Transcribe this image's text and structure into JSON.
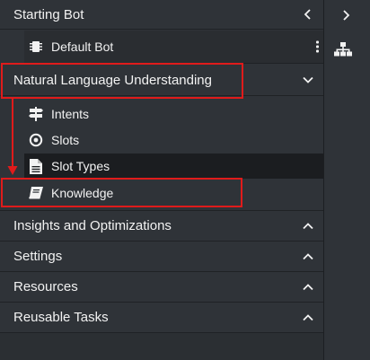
{
  "bot_section": {
    "title": "Starting Bot",
    "item_label": "Default Bot"
  },
  "nlu_section": {
    "title": "Natural Language Understanding",
    "items": [
      {
        "label": "Intents",
        "icon": "signpost-icon"
      },
      {
        "label": "Slots",
        "icon": "target-circle-icon"
      },
      {
        "label": "Slot Types",
        "icon": "document-icon"
      },
      {
        "label": "Knowledge",
        "icon": "book-icon"
      }
    ]
  },
  "collapsed_sections": [
    "Insights and Optimizations",
    "Settings",
    "Resources",
    "Reusable Tasks"
  ],
  "colors": {
    "panel_bg": "#2f3338",
    "selected_bg": "#1b1d20",
    "annotation_red": "#e01b1b"
  }
}
